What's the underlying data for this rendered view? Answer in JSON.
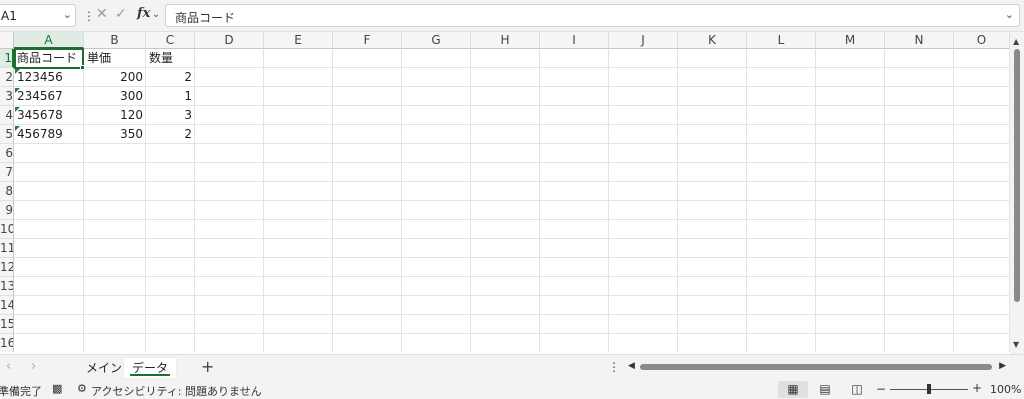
{
  "formula_bar": {
    "name_box": "A1",
    "formula": "商品コード"
  },
  "columns": [
    "A",
    "B",
    "C",
    "D",
    "E",
    "F",
    "G",
    "H",
    "I",
    "J",
    "K",
    "L",
    "M",
    "N",
    "O"
  ],
  "rows": [
    "1",
    "2",
    "3",
    "4",
    "5",
    "6",
    "7",
    "8",
    "9",
    "10",
    "11",
    "12",
    "13",
    "14",
    "15",
    "16"
  ],
  "cells": {
    "header": {
      "a": "商品コード",
      "b": "単価",
      "c": "数量"
    },
    "data": [
      {
        "a": "123456",
        "b": "200",
        "c": "2"
      },
      {
        "a": "234567",
        "b": "300",
        "c": "1"
      },
      {
        "a": "345678",
        "b": "120",
        "c": "3"
      },
      {
        "a": "456789",
        "b": "350",
        "c": "2"
      }
    ]
  },
  "selected_cell": "A1",
  "sheets": [
    "メイン",
    "データ"
  ],
  "active_sheet": "データ",
  "status": {
    "ready": "準備完了",
    "accessibility": "アクセシビリティ: 問題ありません",
    "zoom": "100%"
  },
  "colors": {
    "accent": "#137333",
    "selection": "#1e6b36"
  },
  "icons": {
    "cancel": "cancel-icon",
    "enter": "enter-icon",
    "fx": "function-icon",
    "macro": "macro-icon",
    "accessibility": "accessibility-icon"
  }
}
